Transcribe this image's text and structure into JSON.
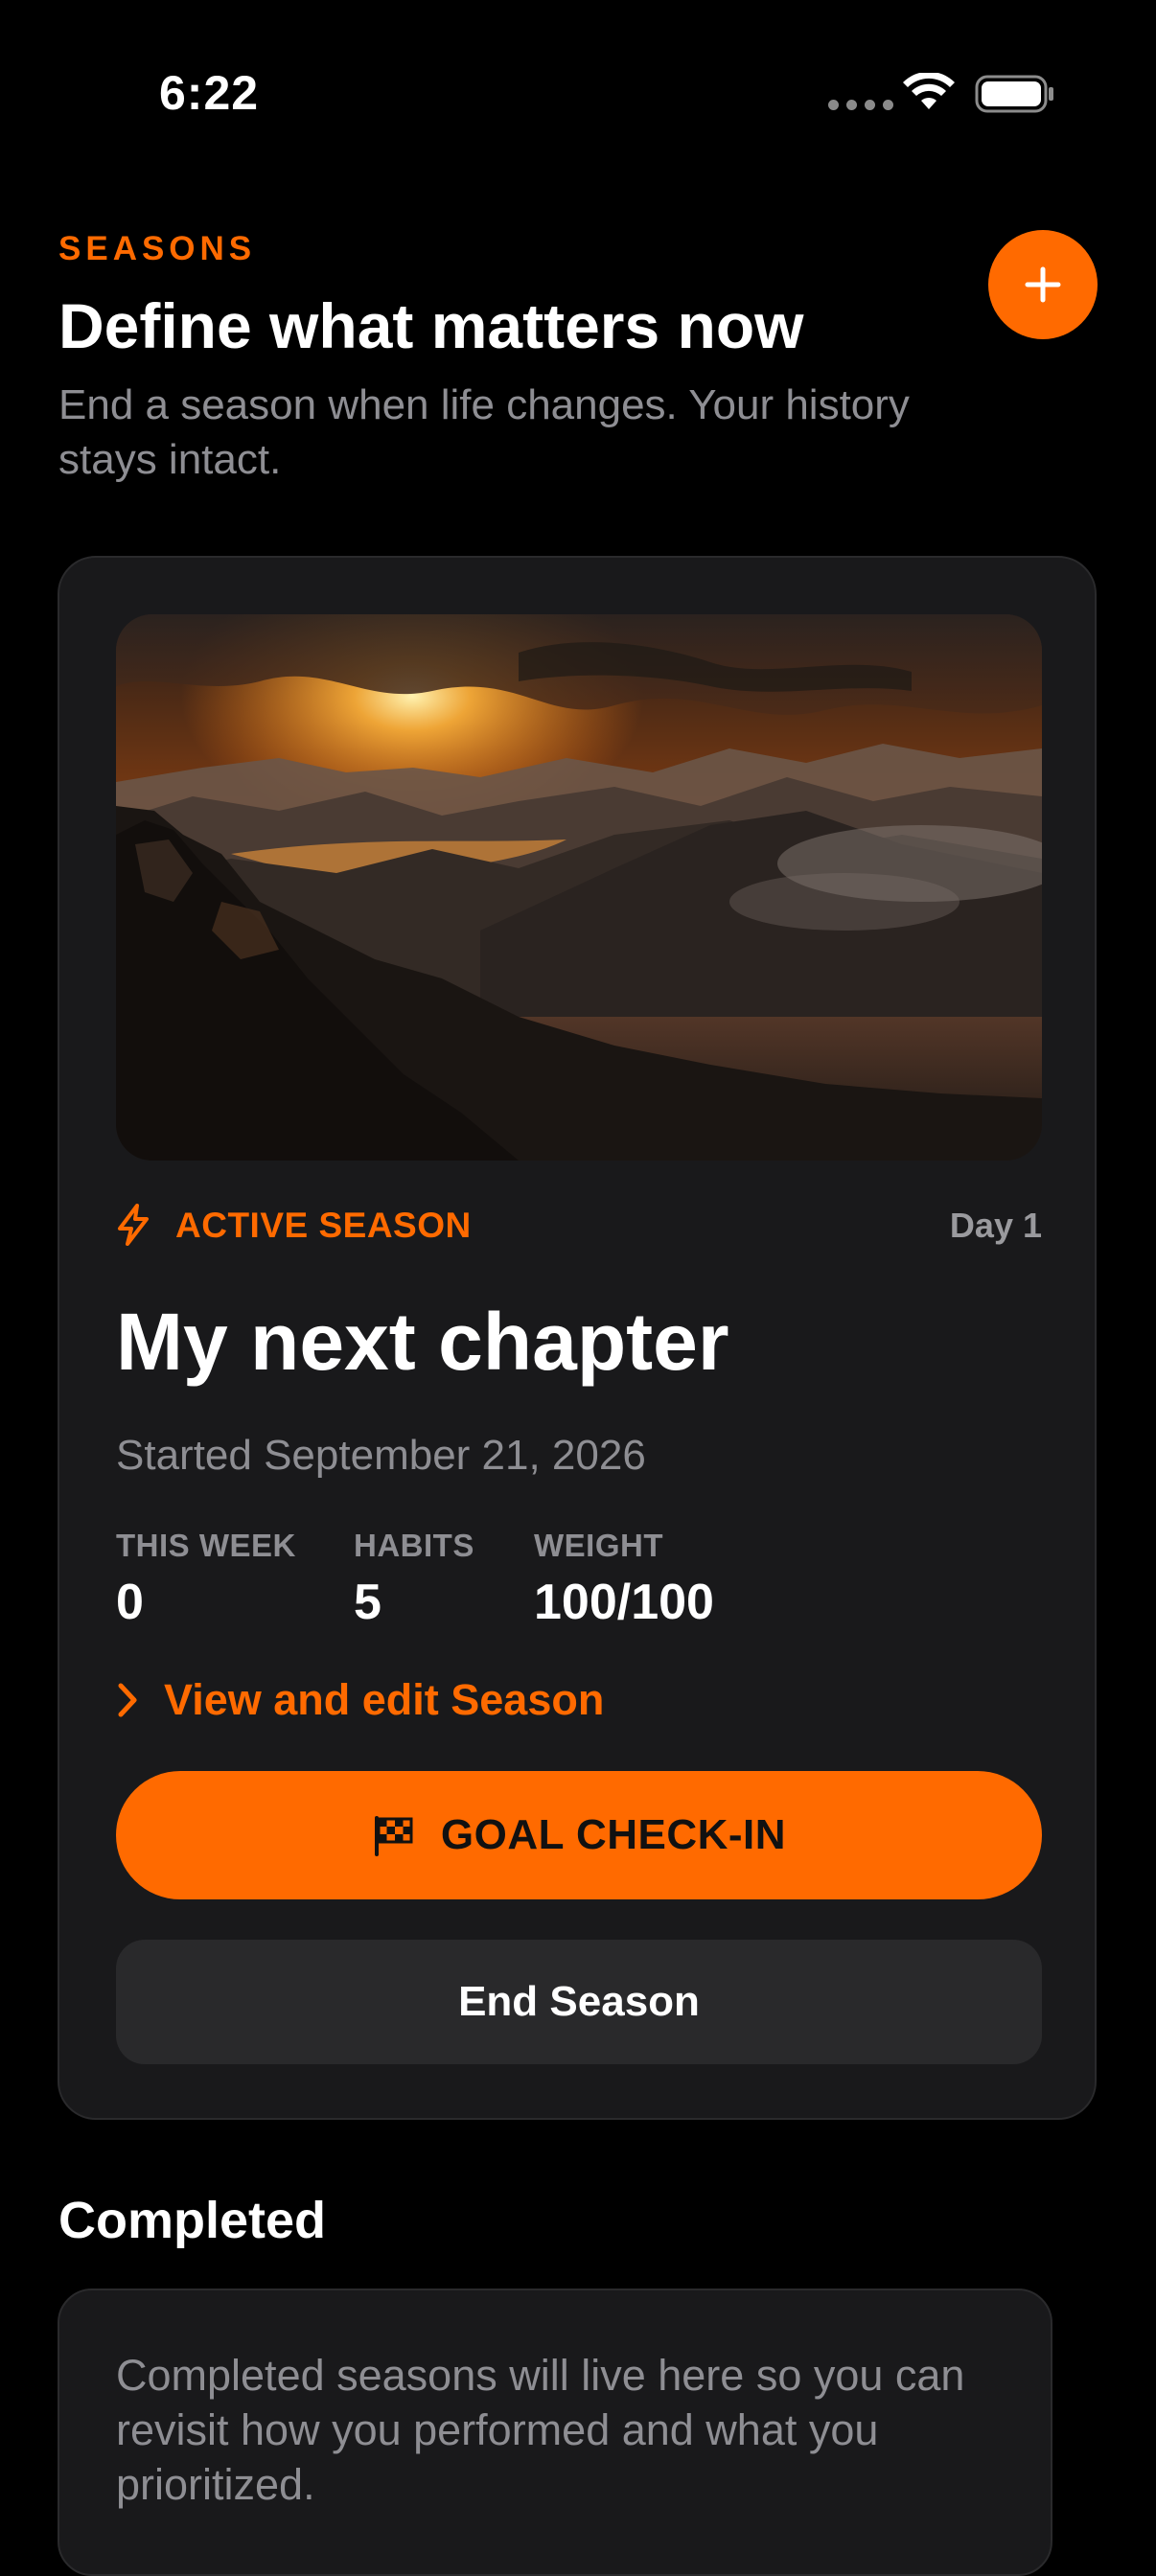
{
  "status_bar": {
    "time": "6:22"
  },
  "header": {
    "eyebrow": "SEASONS",
    "title": "Define what matters now",
    "subtitle": "End a season when life changes. Your history stays intact."
  },
  "active_season": {
    "badge_label": "ACTIVE SEASON",
    "day_label": "Day 1",
    "name": "My next chapter",
    "started": "Started September 21, 2026",
    "stats": [
      {
        "label": "THIS WEEK",
        "value": "0"
      },
      {
        "label": "HABITS",
        "value": "5"
      },
      {
        "label": "WEIGHT",
        "value": "100/100"
      }
    ],
    "view_link_label": "View and edit Season",
    "checkin_label": "GOAL CHECK-IN",
    "end_label": "End Season"
  },
  "completed": {
    "heading": "Completed",
    "empty_text": "Completed seasons will live here so you can revisit how you performed and what you prioritized."
  },
  "icons": {
    "add": "plus-icon",
    "bolt": "lightning-bolt-icon",
    "chevron": "chevron-right-icon",
    "flag": "checkered-flag-icon",
    "wifi": "wifi-icon",
    "battery": "battery-icon"
  },
  "colors": {
    "accent": "#ff6a00",
    "background": "#000000",
    "card": "#19191b",
    "secondary_text": "#8e8e93"
  }
}
